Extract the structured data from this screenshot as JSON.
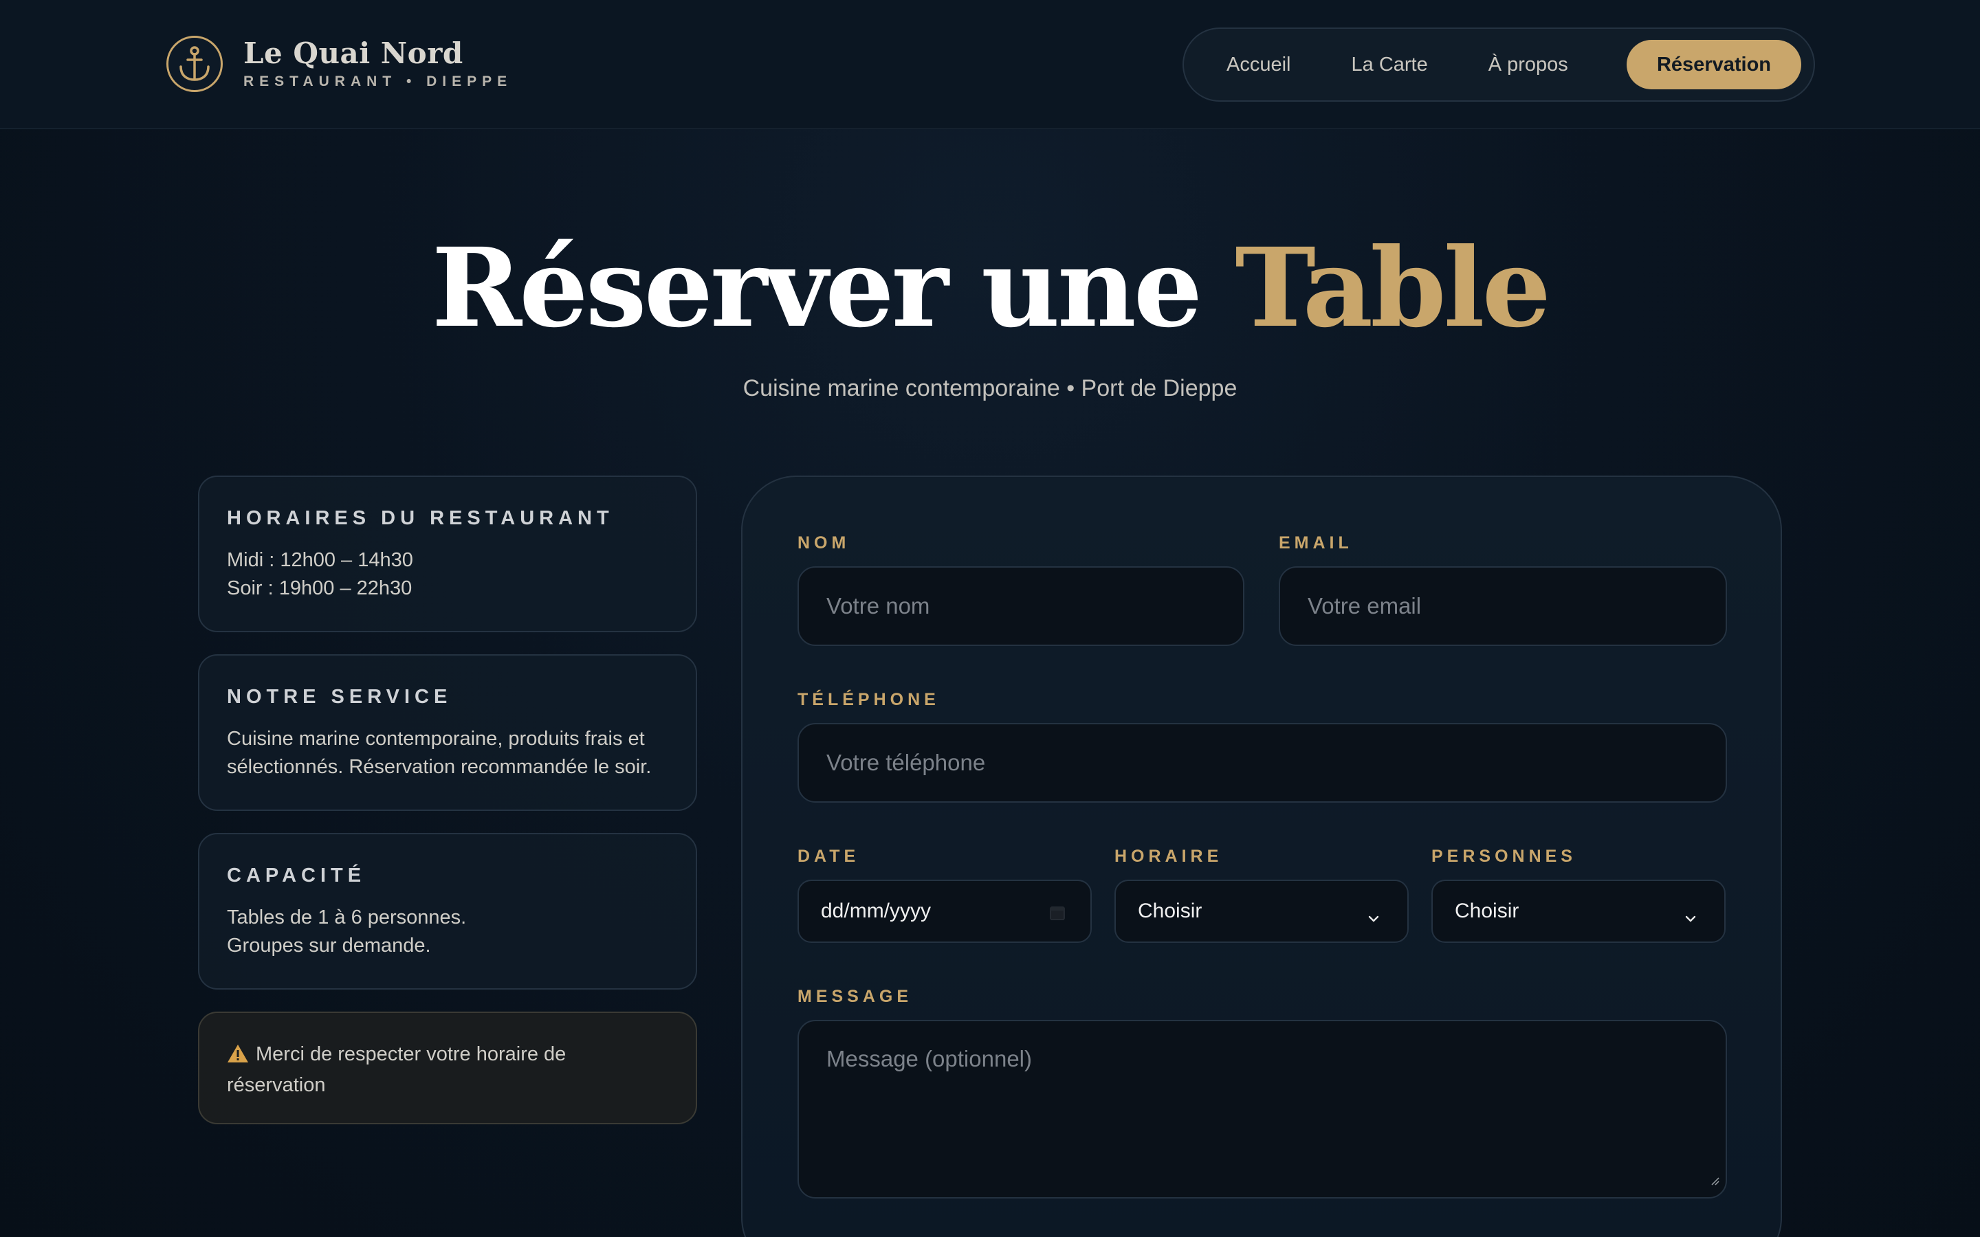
{
  "brand": {
    "name": "Le Quai Nord",
    "subtitle": "RESTAURANT • DIEPPE",
    "logo_icon": "anchor-icon"
  },
  "nav": {
    "items": [
      {
        "label": "Accueil"
      },
      {
        "label": "La Carte"
      },
      {
        "label": "À propos"
      },
      {
        "label": "Réservation",
        "active": true
      }
    ]
  },
  "hero": {
    "title_main": "Réserver une ",
    "title_accent": "Table",
    "subtitle": "Cuisine marine contemporaine • Port de Dieppe"
  },
  "info": {
    "hours": {
      "title": "HORAIRES DU RESTAURANT",
      "lines": [
        "Midi : 12h00 – 14h30",
        "Soir : 19h00 – 22h30"
      ]
    },
    "service": {
      "title": "NOTRE SERVICE",
      "lines": [
        "Cuisine marine contemporaine, produits frais et",
        "sélectionnés. Réservation recommandée le soir."
      ]
    },
    "capacity": {
      "title": "CAPACITÉ",
      "lines": [
        "Tables de 1 à 6 personnes.",
        "Groupes sur demande."
      ]
    },
    "warning": {
      "icon": "warning-icon",
      "lines": [
        "Merci de respecter votre horaire de",
        "réservation"
      ]
    }
  },
  "form": {
    "name": {
      "label": "NOM",
      "placeholder": "Votre nom"
    },
    "email": {
      "label": "EMAIL",
      "placeholder": "Votre email"
    },
    "phone": {
      "label": "TÉLÉPHONE",
      "placeholder": "Votre téléphone"
    },
    "date": {
      "label": "DATE",
      "value": "dd/mm/yyyy"
    },
    "time": {
      "label": "HORAIRE",
      "value": "Choisir"
    },
    "people": {
      "label": "PERSONNES",
      "value": "Choisir"
    },
    "message": {
      "label": "MESSAGE",
      "placeholder": "Message (optionnel)"
    }
  },
  "colors": {
    "accent": "#c9a66b",
    "background": "#0a1420",
    "panel": "#0f1c29"
  }
}
